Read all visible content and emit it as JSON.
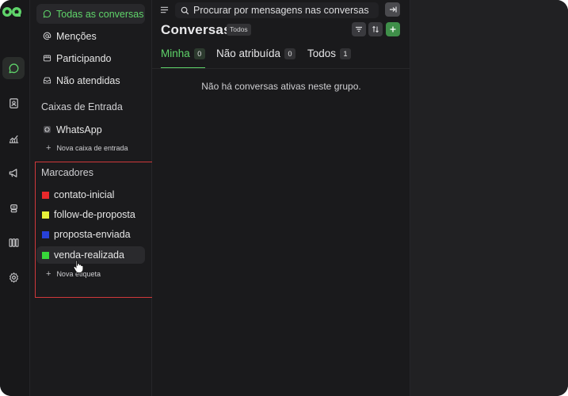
{
  "colors": {
    "accent": "#5fd46a",
    "highlight_border": "#d0383b"
  },
  "rail": {
    "items": [
      {
        "name": "conversations",
        "icon": "chat-bubble-icon",
        "active": true
      },
      {
        "name": "contacts",
        "icon": "contact-book-icon"
      },
      {
        "name": "reports",
        "icon": "line-chart-icon"
      },
      {
        "name": "campaigns",
        "icon": "megaphone-icon"
      },
      {
        "name": "bot",
        "icon": "robot-icon"
      },
      {
        "name": "kanban",
        "icon": "columns-icon"
      },
      {
        "name": "settings",
        "icon": "gear-icon"
      }
    ]
  },
  "sidebar": {
    "nav": [
      {
        "label": "Todas as conversas",
        "icon": "chat-bubble-icon",
        "active": true
      },
      {
        "label": "Menções",
        "icon": "at-sign-icon"
      },
      {
        "label": "Participando",
        "icon": "users-icon"
      },
      {
        "label": "Não atendidas",
        "icon": "inbox-icon"
      }
    ],
    "inboxes_title": "Caixas de Entrada",
    "inboxes": [
      {
        "label": "WhatsApp",
        "icon": "whatsapp-icon"
      }
    ],
    "new_inbox": "Nova caixa de entrada",
    "labels_title": "Marcadores",
    "labels": [
      {
        "label": "contato-inicial",
        "color": "#e8282b"
      },
      {
        "label": "follow-de-proposta",
        "color": "#e5ef3a"
      },
      {
        "label": "proposta-enviada",
        "color": "#2741d8"
      },
      {
        "label": "venda-realizada",
        "color": "#37d63a"
      }
    ],
    "new_label": "Nova etiqueta"
  },
  "main": {
    "search_placeholder": "Procurar por mensagens nas conversas",
    "title": "Conversas",
    "status_chip": "Todos",
    "tabs": [
      {
        "label": "Minha",
        "count": "0",
        "active": true
      },
      {
        "label": "Não atribuída",
        "count": "0"
      },
      {
        "label": "Todos",
        "count": "1"
      }
    ],
    "empty_message": "Não há conversas ativas neste grupo."
  }
}
